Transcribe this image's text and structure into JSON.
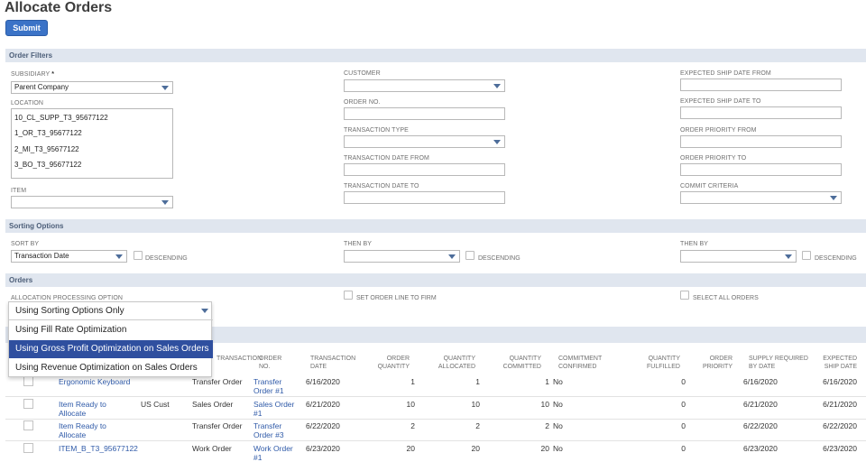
{
  "page": {
    "title": "Allocate Orders",
    "submit_label": "Submit"
  },
  "sections": {
    "order_filters": "Order Filters",
    "sorting_options": "Sorting Options",
    "orders": "Orders"
  },
  "filters": {
    "subsidiary_label": "SUBSIDIARY",
    "subsidiary_required": "*",
    "subsidiary_value": "Parent Company",
    "location_label": "LOCATION",
    "locations": [
      "10_CL_SUPP_T3_95677122",
      "1_OR_T3_95677122",
      "2_MI_T3_95677122",
      "3_BO_T3_95677122"
    ],
    "item_label": "ITEM",
    "customer_label": "CUSTOMER",
    "order_no_label": "ORDER NO.",
    "transaction_type_label": "TRANSACTION TYPE",
    "transaction_date_from_label": "TRANSACTION DATE FROM",
    "transaction_date_to_label": "TRANSACTION DATE TO",
    "expected_ship_from_label": "EXPECTED SHIP DATE FROM",
    "expected_ship_to_label": "EXPECTED SHIP DATE TO",
    "order_priority_from_label": "ORDER PRIORITY FROM",
    "order_priority_to_label": "ORDER PRIORITY TO",
    "commit_criteria_label": "COMMIT CRITERIA"
  },
  "sorting": {
    "sort_by_label": "SORT BY",
    "sort_by_value": "Transaction Date",
    "then_by_label": "THEN BY",
    "descending_label": "DESCENDING"
  },
  "orders": {
    "allocation_option_label": "ALLOCATION PROCESSING OPTION",
    "allocation_selected": "Using Sorting Options Only",
    "allocation_options": [
      "Using Fill Rate Optimization",
      "Using Gross Profit Optimization on Sales Orders",
      "Using Revenue Optimization on Sales Orders"
    ],
    "set_order_line_label": "SET ORDER LINE TO FIRM",
    "select_all_label": "SELECT ALL ORDERS"
  },
  "table": {
    "headers": {
      "transaction": "TRANSACTION",
      "order_no": [
        "ORDER",
        "NO."
      ],
      "transaction_date": [
        "TRANSACTION",
        "DATE"
      ],
      "order_quantity": [
        "ORDER",
        "QUANTITY"
      ],
      "quantity_allocated": [
        "QUANTITY",
        "ALLOCATED"
      ],
      "quantity_committed": [
        "QUANTITY",
        "COMMITTED"
      ],
      "commitment_confirmed": [
        "COMMITMENT",
        "CONFIRMED"
      ],
      "quantity_fulfilled": [
        "QUANTITY",
        "FULFILLED"
      ],
      "order_priority": [
        "ORDER",
        "PRIORITY"
      ],
      "supply_required": [
        "SUPPLY REQUIRED",
        "BY DATE"
      ],
      "expected_ship": [
        "EXPECTED",
        "SHIP DATE"
      ]
    },
    "rows": [
      {
        "item": [
          "Ergonomic Keyboard"
        ],
        "customer": "",
        "type": "Transfer Order",
        "order": [
          "Transfer",
          "Order #1"
        ],
        "date": "6/16/2020",
        "order_qty": "1",
        "alloc": "1",
        "committed": "1",
        "confirmed": "No",
        "fulfilled": "0",
        "priority": "",
        "supply_date": "6/16/2020",
        "ship_date": "6/16/2020"
      },
      {
        "item": [
          "Item Ready to",
          "Allocate"
        ],
        "customer": "US Cust",
        "type": "Sales Order",
        "order": [
          "Sales Order",
          "#1"
        ],
        "date": "6/21/2020",
        "order_qty": "10",
        "alloc": "10",
        "committed": "10",
        "confirmed": "No",
        "fulfilled": "0",
        "priority": "",
        "supply_date": "6/21/2020",
        "ship_date": "6/21/2020"
      },
      {
        "item": [
          "Item Ready to",
          "Allocate"
        ],
        "customer": "",
        "type": "Transfer Order",
        "order": [
          "Transfer",
          "Order #3"
        ],
        "date": "6/22/2020",
        "order_qty": "2",
        "alloc": "2",
        "committed": "2",
        "confirmed": "No",
        "fulfilled": "0",
        "priority": "",
        "supply_date": "6/22/2020",
        "ship_date": "6/22/2020"
      },
      {
        "item": [
          "ITEM_B_T3_95677122"
        ],
        "customer": "",
        "type": "Work Order",
        "order": [
          "Work Order",
          "#1"
        ],
        "date": "6/23/2020",
        "order_qty": "20",
        "alloc": "20",
        "committed": "20",
        "confirmed": "No",
        "fulfilled": "0",
        "priority": "",
        "supply_date": "6/23/2020",
        "ship_date": "6/23/2020"
      }
    ]
  }
}
